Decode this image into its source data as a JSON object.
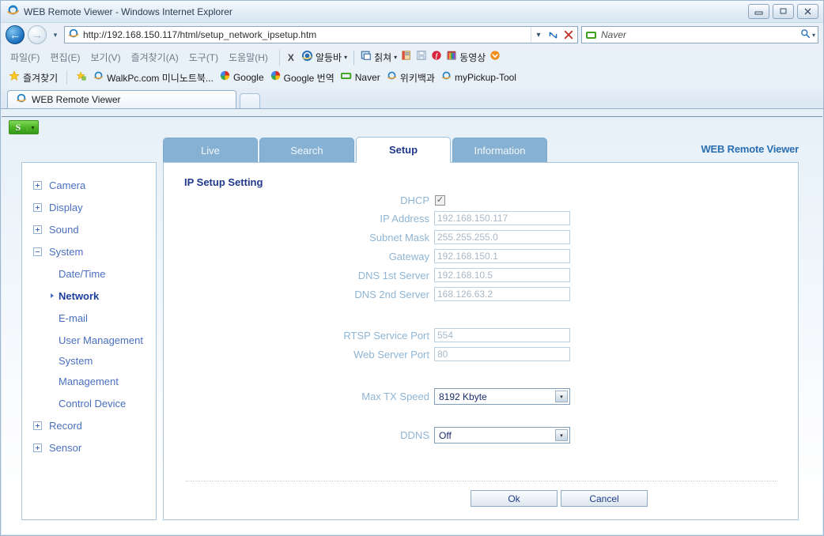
{
  "window": {
    "title": "WEB Remote Viewer - Windows Internet Explorer",
    "controls": {
      "minimize": "–",
      "maximize": "□",
      "close": "✕"
    }
  },
  "nav": {
    "back_icon": "←",
    "forward_icon": "→",
    "history_caret": "▾",
    "url": "http://192.168.150.117/html/setup_network_ipsetup.htm",
    "url_dropdown_caret": "▾",
    "refresh_icon": "↻",
    "stop_icon": "✕"
  },
  "search": {
    "provider": "Naver",
    "go_icon": "⚲",
    "caret": "▾"
  },
  "menubar": {
    "items": [
      {
        "label": "파일(F)"
      },
      {
        "label": "편집(E)"
      },
      {
        "label": "보기(V)"
      },
      {
        "label": "즐겨찾기(A)"
      },
      {
        "label": "도구(T)"
      },
      {
        "label": "도움말(H)"
      }
    ]
  },
  "addonbar": {
    "close_label": "X",
    "items": [
      {
        "label": "알등바",
        "icon": "ie-blue-icon",
        "caret": "▾"
      },
      {
        "label": "칡쳐",
        "icon": "capture-icon",
        "caret": "▾"
      },
      {
        "label": "",
        "icon": "book-icon",
        "caret": ""
      },
      {
        "label": "",
        "icon": "save-icon",
        "caret": ""
      },
      {
        "label": "",
        "icon": "flash-icon",
        "caret": ""
      },
      {
        "label": "동영상",
        "icon": "video-icon",
        "caret": ""
      },
      {
        "label": "",
        "icon": "orange-circle-icon",
        "caret": ""
      }
    ]
  },
  "favorites": {
    "root_label": "즐겨찾기",
    "items": [
      {
        "label": "",
        "icon": "favorites-folder-icon"
      },
      {
        "label": "WalkPc.com 미니노트북...",
        "icon": "ie-icon"
      },
      {
        "label": "Google",
        "icon": "google-icon"
      },
      {
        "label": "Google 번역",
        "icon": "google-icon"
      },
      {
        "label": "Naver",
        "icon": "naver-icon"
      },
      {
        "label": "위키백과",
        "icon": "ie-icon"
      },
      {
        "label": "myPickup-Tool",
        "icon": "ie-icon"
      }
    ]
  },
  "browser_tab": {
    "label": "WEB Remote Viewer"
  },
  "page": {
    "green_badge": {
      "label": "S",
      "caret": "▾"
    },
    "brand": "WEB Remote Viewer",
    "tabs": [
      {
        "label": "Live",
        "active": false
      },
      {
        "label": "Search",
        "active": false
      },
      {
        "label": "Setup",
        "active": true
      },
      {
        "label": "Information",
        "active": false
      }
    ],
    "sidebar": {
      "nodes": [
        {
          "label": "Camera",
          "expanded": false
        },
        {
          "label": "Display",
          "expanded": false
        },
        {
          "label": "Sound",
          "expanded": false
        },
        {
          "label": "System",
          "expanded": true
        }
      ],
      "system_children": [
        {
          "label": "Date/Time",
          "selected": false
        },
        {
          "label": "Network",
          "selected": true
        },
        {
          "label": "E-mail",
          "selected": false
        },
        {
          "label": "User Management",
          "selected": false
        },
        {
          "label": "System Management",
          "selected": false
        },
        {
          "label": "Control Device",
          "selected": false
        }
      ],
      "trailing_nodes": [
        {
          "label": "Record",
          "expanded": false
        },
        {
          "label": "Sensor",
          "expanded": false
        }
      ]
    },
    "panel": {
      "title": "IP Setup Setting",
      "fields": [
        {
          "label": "DHCP",
          "type": "checkbox",
          "checked": true
        },
        {
          "label": "IP Address",
          "type": "text",
          "value": "192.168.150.117"
        },
        {
          "label": "Subnet Mask",
          "type": "text",
          "value": "255.255.255.0"
        },
        {
          "label": "Gateway",
          "type": "text",
          "value": "192.168.150.1"
        },
        {
          "label": "DNS 1st Server",
          "type": "text",
          "value": "192.168.10.5"
        },
        {
          "label": "DNS 2nd Server",
          "type": "text",
          "value": "168.126.63.2"
        },
        {
          "label": "RTSP Service Port",
          "type": "text",
          "value": "554"
        },
        {
          "label": "Web Server Port",
          "type": "text",
          "value": "80"
        },
        {
          "label": "Max TX Speed",
          "type": "select",
          "value": "8192 Kbyte",
          "caret": "▾"
        },
        {
          "label": "DDNS",
          "type": "select",
          "value": "Off",
          "caret": "▾"
        }
      ],
      "buttons": [
        {
          "label": "Ok"
        },
        {
          "label": "Cancel"
        }
      ]
    }
  },
  "colors": {
    "tab_inactive": "#86b1d2",
    "brand_blue": "#2a6fb0",
    "tree_blue": "#4a6fbf",
    "label_blue": "#8fb5d4",
    "title_navy": "#1f3a8a"
  }
}
